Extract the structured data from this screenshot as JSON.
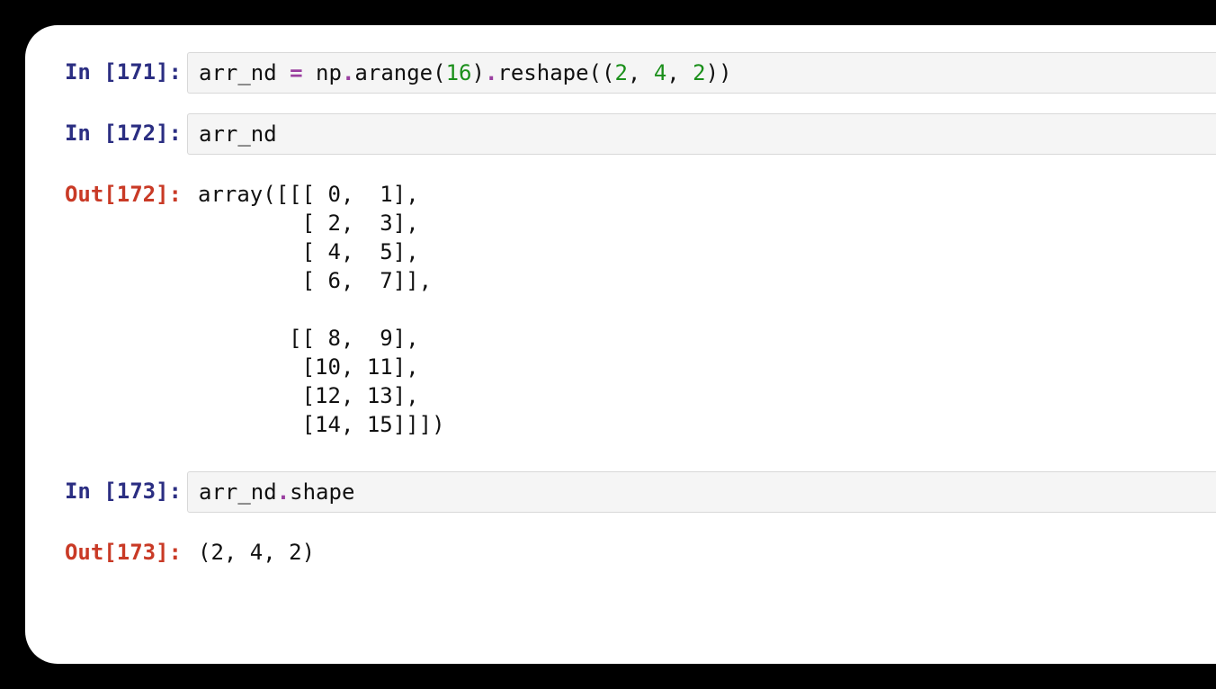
{
  "cells": [
    {
      "type": "in",
      "number": 171,
      "prompt": "In [171]:",
      "tokens": [
        {
          "cls": "tok-name",
          "t": "arr_nd "
        },
        {
          "cls": "tok-op",
          "t": "="
        },
        {
          "cls": "tok-name",
          "t": " np"
        },
        {
          "cls": "tok-op",
          "t": "."
        },
        {
          "cls": "tok-name",
          "t": "arange"
        },
        {
          "cls": "tok-punc",
          "t": "("
        },
        {
          "cls": "tok-num",
          "t": "16"
        },
        {
          "cls": "tok-punc",
          "t": ")"
        },
        {
          "cls": "tok-op",
          "t": "."
        },
        {
          "cls": "tok-name",
          "t": "reshape"
        },
        {
          "cls": "tok-punc",
          "t": "(("
        },
        {
          "cls": "tok-num",
          "t": "2"
        },
        {
          "cls": "tok-punc",
          "t": ", "
        },
        {
          "cls": "tok-num",
          "t": "4"
        },
        {
          "cls": "tok-punc",
          "t": ", "
        },
        {
          "cls": "tok-num",
          "t": "2"
        },
        {
          "cls": "tok-punc",
          "t": "))"
        }
      ]
    },
    {
      "type": "in",
      "number": 172,
      "prompt": "In [172]:",
      "tokens": [
        {
          "cls": "tok-name",
          "t": "arr_nd"
        }
      ]
    },
    {
      "type": "out",
      "number": 172,
      "prompt": "Out[172]:",
      "text": "array([[[ 0,  1],\n        [ 2,  3],\n        [ 4,  5],\n        [ 6,  7]],\n\n       [[ 8,  9],\n        [10, 11],\n        [12, 13],\n        [14, 15]]])"
    },
    {
      "type": "in",
      "number": 173,
      "prompt": "In [173]:",
      "tokens": [
        {
          "cls": "tok-name",
          "t": "arr_nd"
        },
        {
          "cls": "tok-op",
          "t": "."
        },
        {
          "cls": "tok-name",
          "t": "shape"
        }
      ]
    },
    {
      "type": "out",
      "number": 173,
      "prompt": "Out[173]:",
      "text": "(2, 4, 2)"
    }
  ]
}
